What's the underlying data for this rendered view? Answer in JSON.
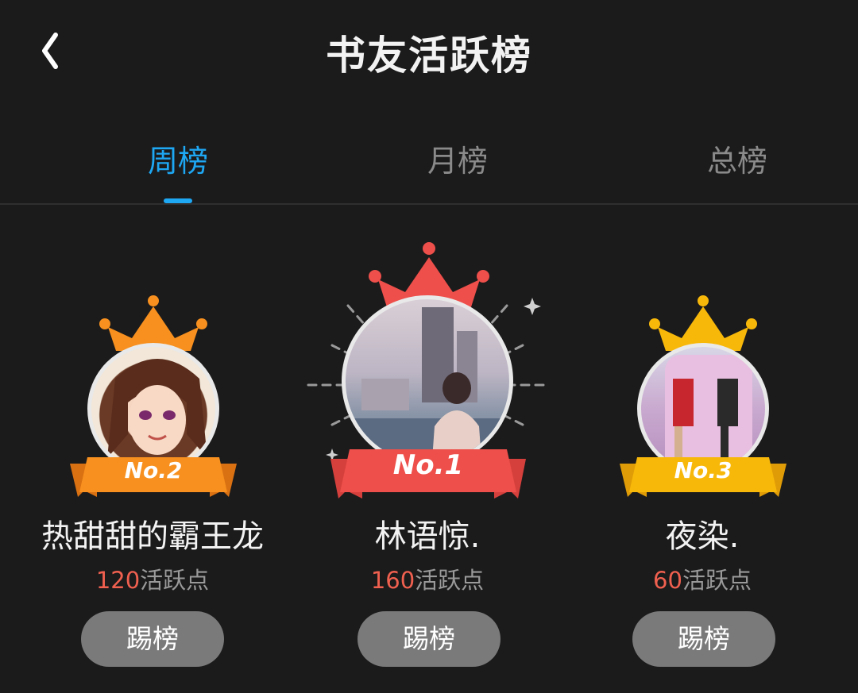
{
  "header": {
    "title": "书友活跃榜"
  },
  "tabs": [
    {
      "label": "周榜",
      "active": true
    },
    {
      "label": "月榜",
      "active": false
    },
    {
      "label": "总榜",
      "active": false
    }
  ],
  "ranking": [
    {
      "rank_label": "No.2",
      "name": "热甜甜的霸王龙",
      "points": "120",
      "points_suffix": "活跃点",
      "button": "踢榜",
      "color": "#f7901e"
    },
    {
      "rank_label": "No.1",
      "name": "林语惊.",
      "points": "160",
      "points_suffix": "活跃点",
      "button": "踢榜",
      "color": "#ee4f4a"
    },
    {
      "rank_label": "No.3",
      "name": "夜染.",
      "points": "60",
      "points_suffix": "活跃点",
      "button": "踢榜",
      "color": "#f8b80a"
    }
  ],
  "colors": {
    "accent": "#1ea7f2",
    "points": "#f0604f"
  }
}
